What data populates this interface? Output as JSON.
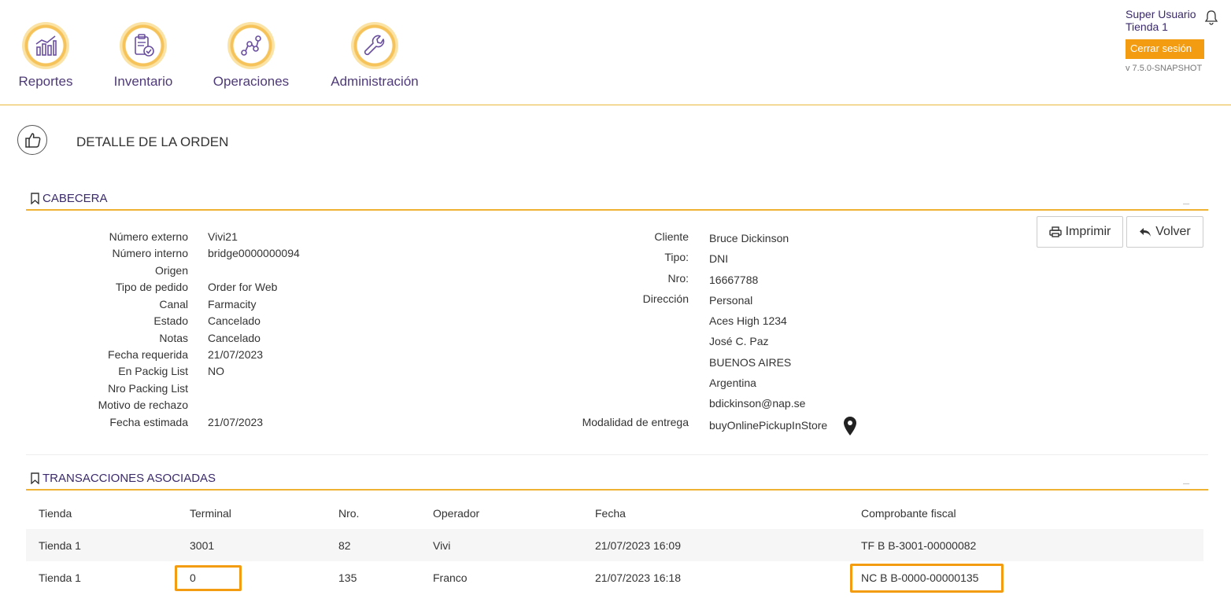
{
  "nav": {
    "items": [
      {
        "label": "Reportes",
        "icon": "chart-icon"
      },
      {
        "label": "Inventario",
        "icon": "clipboard-check-icon"
      },
      {
        "label": "Operaciones",
        "icon": "route-icon"
      },
      {
        "label": "Administración",
        "icon": "wrench-icon"
      }
    ]
  },
  "user": {
    "name": "Super Usuario",
    "store": "Tienda 1",
    "logout_label": "Cerrar sesión",
    "version": "v 7.5.0-SNAPSHOT"
  },
  "page": {
    "title": "DETALLE DE LA ORDEN"
  },
  "cabecera": {
    "title": "CABECERA",
    "collapse": "_",
    "print_label": "Imprimir",
    "back_label": "Volver",
    "fields": [
      {
        "label": "Número externo",
        "value": "Vivi21"
      },
      {
        "label": "Número interno",
        "value": "bridge0000000094"
      },
      {
        "label": "Origen",
        "value": ""
      },
      {
        "label": "Tipo de pedido",
        "value": "Order for Web"
      },
      {
        "label": "Canal",
        "value": "Farmacity"
      },
      {
        "label": "Estado",
        "value": "Cancelado"
      },
      {
        "label": "Notas",
        "value": "Cancelado"
      },
      {
        "label": "Fecha requerida",
        "value": "21/07/2023"
      },
      {
        "label": "En Packig List",
        "value": "NO"
      },
      {
        "label": "Nro Packing List",
        "value": ""
      },
      {
        "label": "Motivo de rechazo",
        "value": ""
      },
      {
        "label": "Fecha estimada",
        "value": "21/07/2023"
      }
    ],
    "client": {
      "cliente_label": "Cliente",
      "cliente": "Bruce Dickinson",
      "tipo_label": "Tipo:",
      "tipo": "DNI",
      "nro_label": "Nro:",
      "nro": "16667788",
      "direccion_label": "Dirección",
      "direccion": [
        "Personal",
        "Aces High 1234",
        "José C. Paz",
        "BUENOS AIRES",
        "Argentina",
        "bdickinson@nap.se"
      ],
      "modalidad_label": "Modalidad de entrega",
      "modalidad": "buyOnlinePickupInStore"
    }
  },
  "transacciones": {
    "title": "TRANSACCIONES ASOCIADAS",
    "collapse": "_",
    "columns": [
      "Tienda",
      "Terminal",
      "Nro.",
      "Operador",
      "Fecha",
      "Comprobante fiscal"
    ],
    "rows": [
      [
        "Tienda 1",
        "3001",
        "82",
        "Vivi",
        "21/07/2023 16:09",
        "TF B B-3001-00000082"
      ],
      [
        "Tienda 1",
        "0",
        "135",
        "Franco",
        "21/07/2023 16:18",
        "NC B B-0000-00000135"
      ]
    ],
    "highlight_color": "#f39c12"
  }
}
